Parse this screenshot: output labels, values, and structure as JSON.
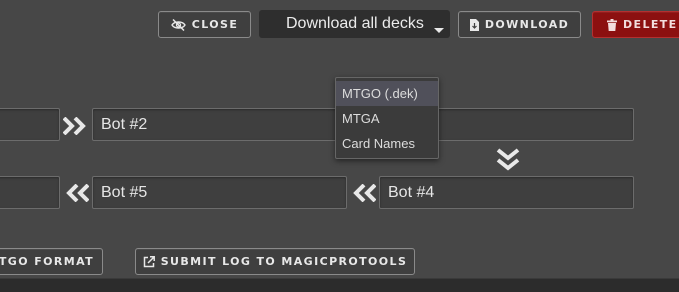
{
  "toolbar": {
    "close_label": "CLOSE",
    "download_select": {
      "selected": "Download all decks"
    },
    "download_label": "DOWNLOAD",
    "delete_label": "DELETE"
  },
  "download_menu": {
    "options": [
      "MTGO (.dek)",
      "MTGA",
      "Card Names"
    ],
    "highlighted": "MTGO (.dek)"
  },
  "players": {
    "row1": {
      "right_label": "Bot #2"
    },
    "row2": {
      "middle_label": "Bot #5",
      "right_label": "Bot #4"
    }
  },
  "footer": {
    "mtgo_format_label": "TGO FORMAT",
    "submit_log_label": "SUBMIT LOG TO MAGICPROTOOLS"
  },
  "colors": {
    "background": "#474747",
    "delete_button": "#8c1010",
    "field": "#3f3f3f",
    "arrow": "#e8e8e8"
  },
  "icons": {
    "close": "eye-slash-icon",
    "download": "file-download-icon",
    "delete": "trash-icon",
    "external": "external-link-icon",
    "arrows": "double-chevron-icon"
  }
}
